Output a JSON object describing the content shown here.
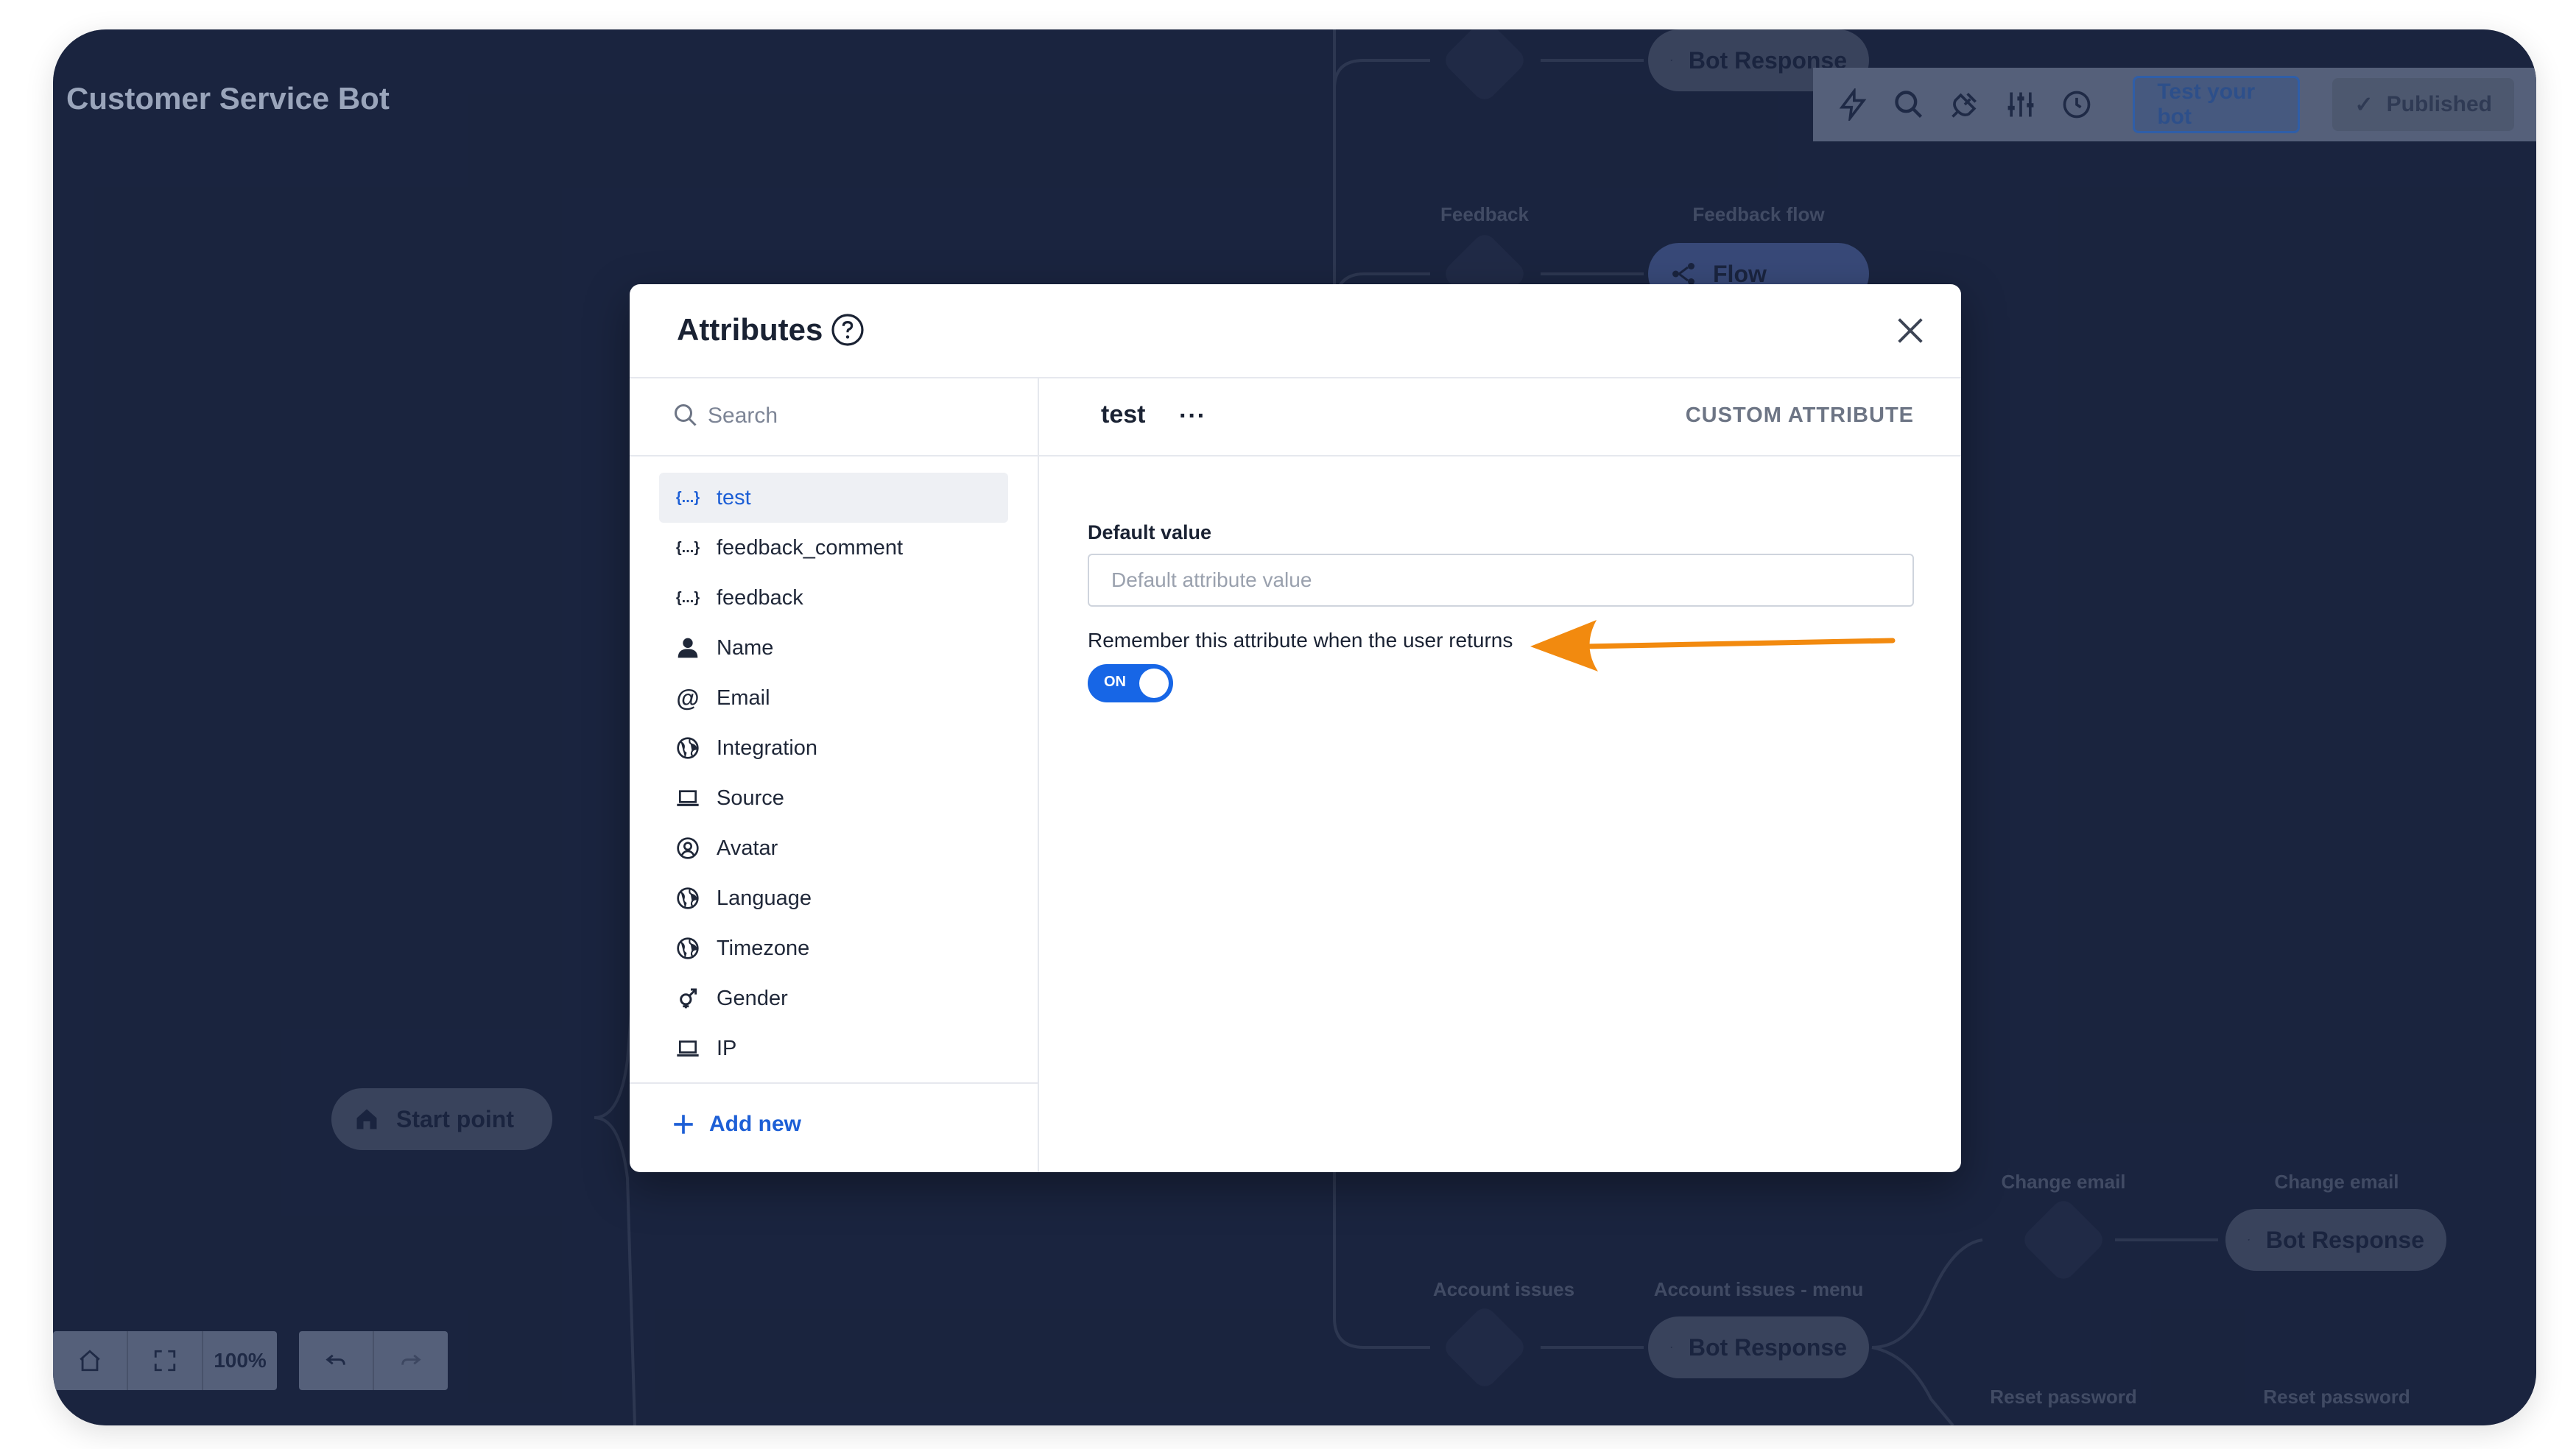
{
  "app": {
    "title": "Customer Service Bot"
  },
  "toolbar": {
    "icons": [
      "bolt-icon",
      "search-icon",
      "plug-icon",
      "sliders-icon",
      "history-icon"
    ],
    "test_label": "Test your bot",
    "published_label": "Published"
  },
  "canvas": {
    "start_label": "Start point",
    "nodes": {
      "top_response": "Bot Response",
      "feedback_label": "Feedback",
      "feedback_flow_label": "Feedback flow",
      "flow_pill": "Flow",
      "account_issues_label": "Account issues",
      "account_menu_label": "Account issues - menu",
      "account_response": "Bot Response",
      "change_email_label_1": "Change email",
      "change_email_label_2": "Change email",
      "change_email_response": "Bot Response",
      "reset_password_label_1": "Reset password",
      "reset_password_label_2": "Reset password"
    },
    "zoom": "100%"
  },
  "modal": {
    "title": "Attributes",
    "search_placeholder": "Search",
    "attributes": [
      {
        "label": "test",
        "icon": "{...}",
        "icon_name": "braces-icon",
        "selected": true
      },
      {
        "label": "feedback_comment",
        "icon": "{...}",
        "icon_name": "braces-icon"
      },
      {
        "label": "feedback",
        "icon": "{...}",
        "icon_name": "braces-icon"
      },
      {
        "label": "Name",
        "icon": "",
        "icon_name": "user-icon"
      },
      {
        "label": "Email",
        "icon": "@",
        "icon_name": "at-icon"
      },
      {
        "label": "Integration",
        "icon": "",
        "icon_name": "globe-icon"
      },
      {
        "label": "Source",
        "icon": "",
        "icon_name": "laptop-icon"
      },
      {
        "label": "Avatar",
        "icon": "",
        "icon_name": "avatar-icon"
      },
      {
        "label": "Language",
        "icon": "",
        "icon_name": "globe-icon"
      },
      {
        "label": "Timezone",
        "icon": "",
        "icon_name": "globe-icon"
      },
      {
        "label": "Gender",
        "icon": "",
        "icon_name": "gender-icon"
      },
      {
        "label": "IP",
        "icon": "",
        "icon_name": "laptop-icon"
      }
    ],
    "add_new": "Add new",
    "detail": {
      "name": "test",
      "more": "···",
      "type": "CUSTOM ATTRIBUTE",
      "default_label": "Default value",
      "default_value": "",
      "default_placeholder": "Default attribute value",
      "remember_label": "Remember this attribute when the user returns",
      "toggle_text": "ON",
      "toggle_on": true
    }
  },
  "colors": {
    "accent": "#1766e6",
    "link": "#1d5fd6",
    "annotation_arrow": "#f28a0f",
    "canvas_bg": "#1f2a46"
  }
}
